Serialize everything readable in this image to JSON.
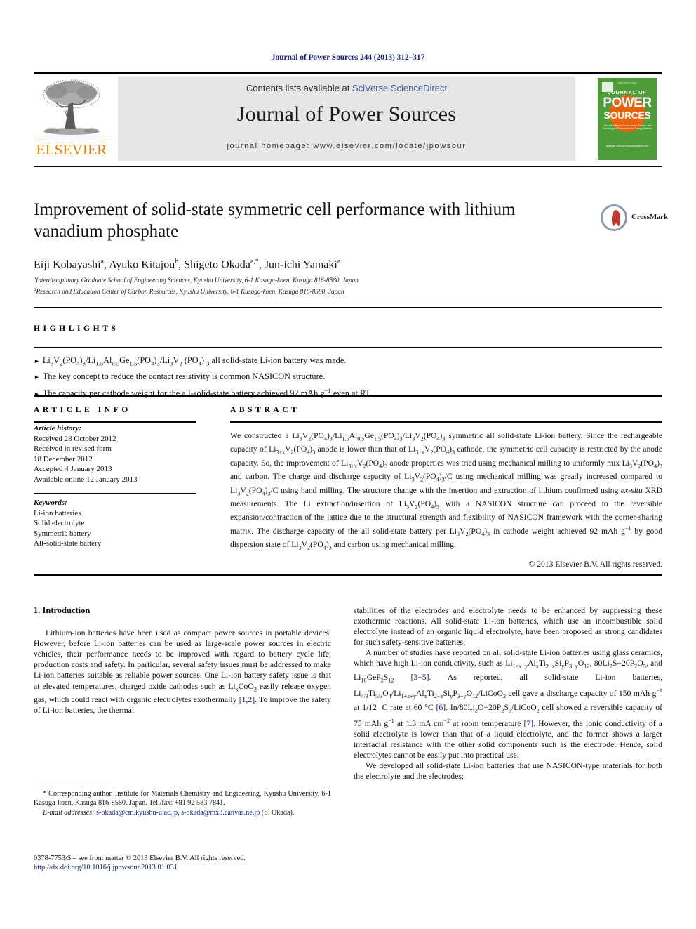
{
  "running_head": "Journal of Power Sources 244 (2013) 312–317",
  "masthead": {
    "contents_prefix": "Contents lists available at ",
    "contents_link": "SciVerse ScienceDirect",
    "journal_name": "Journal of Power Sources",
    "homepage": "journal homepage: www.elsevier.com/locate/jpowsour",
    "publisher": "ELSEVIER",
    "publisher_logo_icon": "elsevier-tree-icon",
    "cover": {
      "top_text": "ISSN 0378-7753",
      "journal_of": "JOURNAL OF",
      "power": "POWER",
      "sources": "SOURCES",
      "subtitle": "The International Journal on the Science and Technology of Electrochemical Energy Systems",
      "footer": "Available online at www.sciencedirect.com"
    }
  },
  "article": {
    "title": "Improvement of solid-state symmetric cell performance with lithium vanadium phosphate",
    "crossmark_label": "CrossMark",
    "crossmark_icon": "crossmark-icon",
    "authors_html": "Eiji Kobayashi<sup>a</sup>, Ayuko Kitajou<sup>b</sup>, Shigeto Okada<sup>a,*</sup>, Jun-ichi Yamaki<sup>a</sup>",
    "affiliations": [
      "Interdisciplinary Graduate School of Engineering Sciences, Kyushu University, 6-1 Kasuga-koen, Kasuga 816-8580, Japan",
      "Research and Education Center of Carbon Resources, Kyushu University, 6-1 Kasuga-koen, Kasuga 816-8580, Japan"
    ],
    "affiliation_marks": [
      "a",
      "b"
    ]
  },
  "highlights": {
    "heading": "HIGHLIGHTS",
    "bullet_glyph": "►",
    "items_html": [
      "Li<sub>3</sub>V<sub>2</sub>(PO<sub>4</sub>)<sub>3</sub>/Li<sub>1.5</sub>Al<sub>0.5</sub>Ge<sub>1.5</sub>(PO<sub>4</sub>)<sub>3</sub>/Li<sub>3</sub>V<sub>2</sub> (PO<sub>4</sub>) <sub>3</sub> all solid-state Li-ion battery was made.",
      "The key concept to reduce the contact resistivity is common NASICON structure.",
      "The capacity per cathode weight for the all-solid-state battery achieved 92 mAh g<sup>−1</sup> even at RT."
    ]
  },
  "article_info": {
    "heading": "ARTICLE INFO",
    "history_label": "Article history:",
    "history": [
      "Received 28 October 2012",
      "Received in revised form",
      "18 December 2012",
      "Accepted 4 January 2013",
      "Available online 12 January 2013"
    ],
    "keywords_label": "Keywords:",
    "keywords": [
      "Li-ion batteries",
      "Solid electrolyte",
      "Symmetric battery",
      "All-solid-state battery"
    ]
  },
  "abstract": {
    "heading": "ABSTRACT",
    "text_html": "We constructed a Li<sub>3</sub>V<sub>2</sub>(PO<sub>4</sub>)<sub>3</sub>/Li<sub>1.5</sub>Al<sub>0.5</sub>Ge<sub>1.5</sub>(PO<sub>4</sub>)<sub>3</sub>/Li<sub>3</sub>V<sub>2</sub>(PO<sub>4</sub>)<sub>3</sub> symmetric all solid-state Li-ion battery. Since the rechargeable capacity of Li<sub>3+x</sub>V<sub>2</sub>(PO<sub>4</sub>)<sub>3</sub> anode is lower than that of Li<sub>3−x</sub>V<sub>2</sub>(PO<sub>4</sub>)<sub>3</sub> cathode, the symmetric cell capacity is restricted by the anode capacity. So, the improvement of Li<sub>3+x</sub>V<sub>2</sub>(PO<sub>4</sub>)<sub>3</sub> anode properties was tried using mechanical milling to uniformly mix Li<sub>3</sub>V<sub>2</sub>(PO<sub>4</sub>)<sub>3</sub> and carbon. The charge and discharge capacity of Li<sub>3</sub>V<sub>2</sub>(PO<sub>4</sub>)<sub>3</sub>/C using mechanical milling was greatly increased compared to Li<sub>3</sub>V<sub>2</sub>(PO<sub>4</sub>)<sub>3</sub>/C using hand milling. The structure change with the insertion and extraction of lithium confirmed using <i>ex-situ</i> XRD measurements. The Li extraction/insertion of Li<sub>3</sub>V<sub>2</sub>(PO<sub>4</sub>)<sub>3</sub> with a NASICON structure can proceed to the reversible expansion/contraction of the lattice due to the structural strength and flexibility of NASICON framework with the corner-sharing matrix. The discharge capacity of the all solid-state battery per Li<sub>3</sub>V<sub>2</sub>(PO<sub>4</sub>)<sub>3</sub> in cathode weight achieved 92 mAh g<sup>−1</sup> by good dispersion state of Li<sub>3</sub>V<sub>2</sub>(PO<sub>4</sub>)<sub>3</sub> and carbon using mechanical milling.",
    "copyright": "© 2013 Elsevier B.V. All rights reserved."
  },
  "body": {
    "section_heading": "1. Introduction",
    "left_paragraphs_html": [
      "Lithium-ion batteries have been used as compact power sources in portable devices. However, before Li-ion batteries can be used as large-scale power sources in electric vehicles, their performance needs to be improved with regard to battery cycle life, production costs and safety. In particular, several safety issues must be addressed to make Li-ion batteries suitable as reliable power sources. One Li-ion battery safety issue is that at elevated temperatures, charged oxide cathodes such as Li<sub>x</sub>CoO<sub>2</sub> easily release oxygen gas, which could react with organic electrolytes exothermally <span class=\"ref\">[1,2]</span>. To improve the safety of Li-ion batteries, the thermal"
    ],
    "right_paragraphs_html": [
      "stabilities of the electrodes and electrolyte needs to be enhanced by suppressing these exothermic reactions. All solid-state Li-ion batteries, which use an incombustible solid electrolyte instead of an organic liquid electrolyte, have been proposed as strong candidates for such safety-sensitive batteries.",
      "A number of studies have reported on all solid-state Li-ion batteries using glass ceramics, which have high Li-ion conductivity, such as Li<sub>1+x+y</sub>Al<sub>x</sub>Ti<sub>2−x</sub>Si<sub>y</sub>P<sub>3−y</sub>O<sub>12</sub>, 80Li<sub>2</sub>S−20P<sub>2</sub>O<sub>5</sub>, and Li<sub>10</sub>GeP<sub>2</sub>S<sub>12</sub> <span class=\"ref\">[3−5]</span>. As reported, all solid-state Li-ion batteries, Li<sub>4/3</sub>Ti<sub>5/3</sub>O<sub>4</sub>/Li<sub>1+x+y</sub>Al<sub>x</sub>Ti<sub>2−x</sub>Si<sub>y</sub>P<sub>3−y</sub>O<sub>12</sub>/LiCoO<sub>2</sub> cell gave a discharge capacity of 150 mAh g<sup>−1</sup> at 1/12&nbsp; C rate at 60 °C <span class=\"ref\">[6]</span>. In/80Li<sub>2</sub>O−20P<sub>2</sub>S<sub>5</sub>/LiCoO<sub>2</sub> cell showed a reversible capacity of 75 mAh g<sup>−1</sup> at 1.3 mA cm<sup>−2</sup> at room temperature <span class=\"ref\">[7]</span>. However, the ionic conductivity of a solid electrolyte is lower than that of a liquid electrolyte, and the former shows a larger interfacial resistance with the other solid components such as the electrode. Hence, solid electrolytes cannot be easily put into practical use.",
      "We developed all solid-state Li-ion batteries that use NASICON-type materials for both the electrolyte and the electrodes;"
    ]
  },
  "footnote": {
    "corresponding_html": "* Corresponding author. Institute for Materials Chemistry and Engineering, Kyushu University, 6-1 Kasuga-koen, Kasuga 816-8580, Japan. Tel./fax: +81 92 583 7841.",
    "email_label": "E-mail addresses:",
    "emails": [
      "s-okada@cm.kyushu-u.ac.jp",
      "s-okada@mx3.canvas.ne.jp"
    ],
    "email_owner": "(S. Okada)."
  },
  "imprint": {
    "issn_line": "0378-7753/$ – see front matter © 2013 Elsevier B.V. All rights reserved.",
    "doi": "http://dx.doi.org/10.1016/j.jpowsour.2013.01.031"
  }
}
